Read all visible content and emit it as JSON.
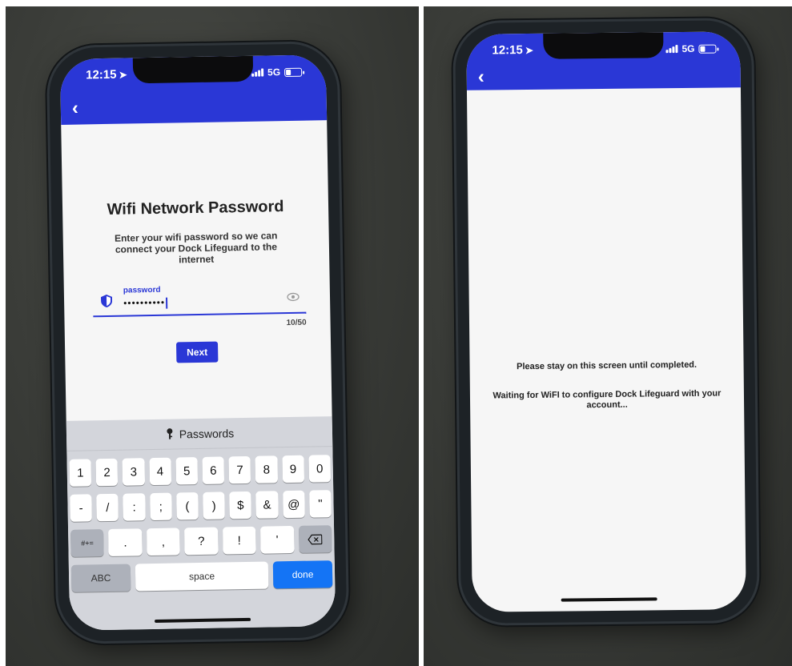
{
  "status": {
    "time": "12:15",
    "network": "5G"
  },
  "left_screen": {
    "title": "Wifi Network Password",
    "subtitle": "Enter your wifi password so we can connect your Dock Lifeguard to the internet",
    "field_label": "password",
    "field_value": "••••••••••",
    "counter": "10/50",
    "next_label": "Next",
    "keyboard": {
      "suggestion": "Passwords",
      "row1": [
        "1",
        "2",
        "3",
        "4",
        "5",
        "6",
        "7",
        "8",
        "9",
        "0"
      ],
      "row2": [
        "-",
        "/",
        ":",
        ";",
        "(",
        ")",
        "$",
        "&",
        "@",
        "\""
      ],
      "row3": [
        "#+=",
        ".",
        ",",
        "?",
        "!",
        "'"
      ],
      "abc_label": "ABC",
      "space_label": "space",
      "done_label": "done"
    }
  },
  "right_screen": {
    "message1": "Please stay on this screen until completed.",
    "message2": "Waiting for WiFI to configure Dock Lifeguard with your account..."
  },
  "colors": {
    "appbar": "#2a37d6",
    "done_key": "#1474f5"
  }
}
